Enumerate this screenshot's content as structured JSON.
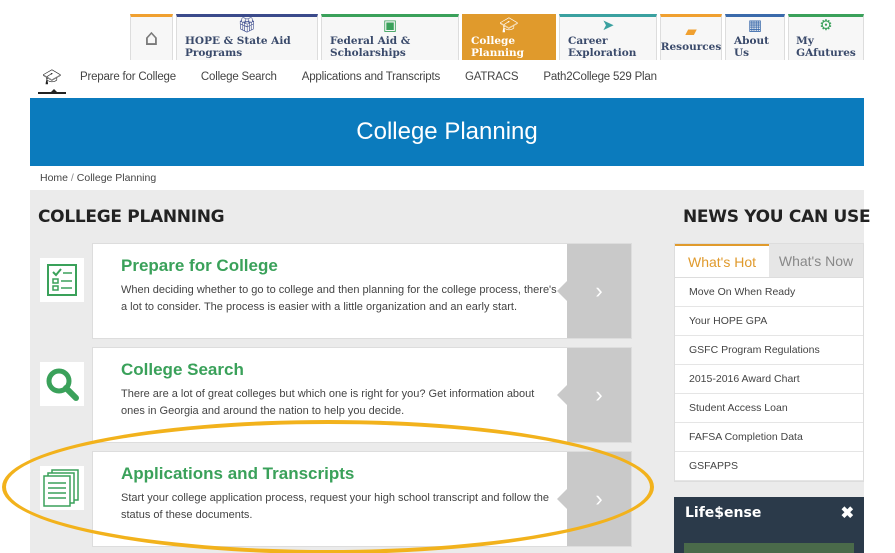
{
  "nav": {
    "tabs": [
      {
        "label": "HOPE & State Aid Programs",
        "icon": "gift-icon",
        "color": "#3a4a8b"
      },
      {
        "label": "Federal Aid & Scholarships",
        "icon": "money-icon",
        "color": "#3aa15a"
      },
      {
        "label": "College Planning",
        "icon": "graduation-cap-icon",
        "color": "#e09a2c"
      },
      {
        "label": "Career Exploration",
        "icon": "paper-plane-icon",
        "color": "#3aa1a0"
      },
      {
        "label": "Resources",
        "icon": "book-icon",
        "color": "#f0a030"
      },
      {
        "label": "About Us",
        "icon": "building-icon",
        "color": "#3a6aab"
      },
      {
        "label": "My GAfutures",
        "icon": "gear-icon",
        "color": "#3aa15a"
      }
    ]
  },
  "subnav": {
    "items": [
      "Prepare for College",
      "College Search",
      "Applications and Transcripts",
      "GATRACS",
      "Path2College 529 Plan"
    ]
  },
  "banner": {
    "title": "College Planning"
  },
  "breadcrumb": {
    "home": "Home",
    "sep": " / ",
    "current": "College Planning"
  },
  "main": {
    "heading": "COLLEGE PLANNING",
    "cards": [
      {
        "title": "Prepare for College",
        "desc": "When deciding whether to go to college and then planning for the college process, there's a lot to consider. The process is easier with a little organization and an early start.",
        "icon": "checklist-icon"
      },
      {
        "title": "College Search",
        "desc": "There are a lot of great colleges but which one is right for you? Get information about ones in Georgia and around the nation to help you decide.",
        "icon": "magnifier-icon"
      },
      {
        "title": "Applications and Transcripts",
        "desc": "Start your college application process, request your high school transcript and follow the status of these documents.",
        "icon": "documents-icon"
      }
    ],
    "arrow": "›"
  },
  "news": {
    "heading": "NEWS YOU CAN USE",
    "tab_hot": "What's Hot",
    "tab_now": "What's Now",
    "items": [
      "Move On When Ready",
      "Your HOPE GPA",
      "GSFC Program Regulations",
      "2015-2016 Award Chart",
      "Student Access Loan",
      "FAFSA Completion Data",
      "GSFAPPS"
    ]
  },
  "lifesense": {
    "title": "Life$ense",
    "close": "✖"
  },
  "colors": {
    "accent": "#e09a2c",
    "banner": "#0b7bbd",
    "green": "#3aa15a",
    "highlight": "#f2b21c"
  }
}
